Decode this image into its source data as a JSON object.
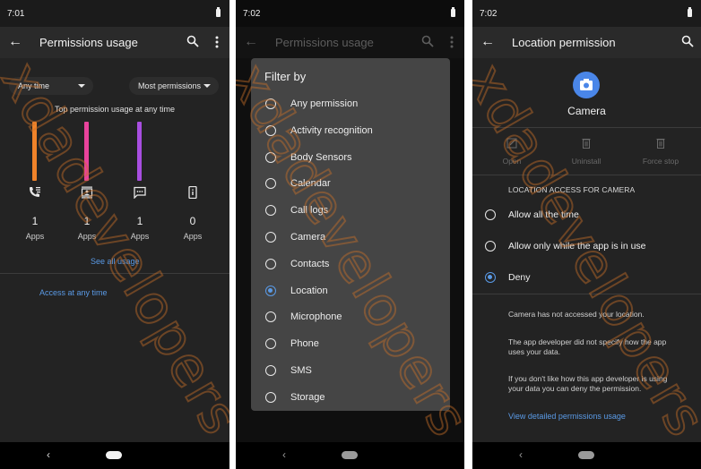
{
  "panels": [
    {
      "status_time": "7:01",
      "title": "Permissions usage",
      "filters": {
        "time": "Any time",
        "sort": "Most permissions"
      },
      "chart_title": "Top permission usage at any time",
      "chart_data": {
        "type": "bar",
        "categories": [
          "Call logs",
          "Camera",
          "SMS",
          "Phone"
        ],
        "values": [
          1,
          1,
          1,
          0
        ],
        "colors": [
          "#f0832a",
          "#e8439c",
          "#a84ee0",
          "#888888"
        ],
        "ylim": [
          0,
          1
        ]
      },
      "usage": [
        {
          "icon": "call-log-icon",
          "count": "1",
          "label": "Apps"
        },
        {
          "icon": "camera-contact-icon",
          "count": "1",
          "label": "Apps"
        },
        {
          "icon": "sms-icon",
          "count": "1",
          "label": "Apps"
        },
        {
          "icon": "phone-icon",
          "count": "0",
          "label": "Apps"
        }
      ],
      "see_all": "See all usage",
      "access_link": "Access at any time"
    },
    {
      "status_time": "7:02",
      "title": "Permissions usage",
      "dialog": {
        "title": "Filter by",
        "selected": "Location",
        "options": [
          "Any permission",
          "Activity recognition",
          "Body Sensors",
          "Calendar",
          "Call logs",
          "Camera",
          "Contacts",
          "Location",
          "Microphone",
          "Phone",
          "SMS",
          "Storage"
        ]
      }
    },
    {
      "status_time": "7:02",
      "title": "Location permission",
      "app_name": "Camera",
      "actions": [
        "Open",
        "Uninstall",
        "Force stop"
      ],
      "section_header": "LOCATION ACCESS FOR CAMERA",
      "selected": "Deny",
      "options": [
        "Allow all the time",
        "Allow only while the app is in use",
        "Deny"
      ],
      "info": [
        "Camera has not accessed your location.",
        "The app developer did not specify how the app uses your data.",
        "If you don't like how this app developer is using your data you can deny the permission."
      ],
      "link": "View detailed permissions usage"
    }
  ],
  "watermark": "xdadevelopers",
  "accent_color": "#5a9ae6"
}
